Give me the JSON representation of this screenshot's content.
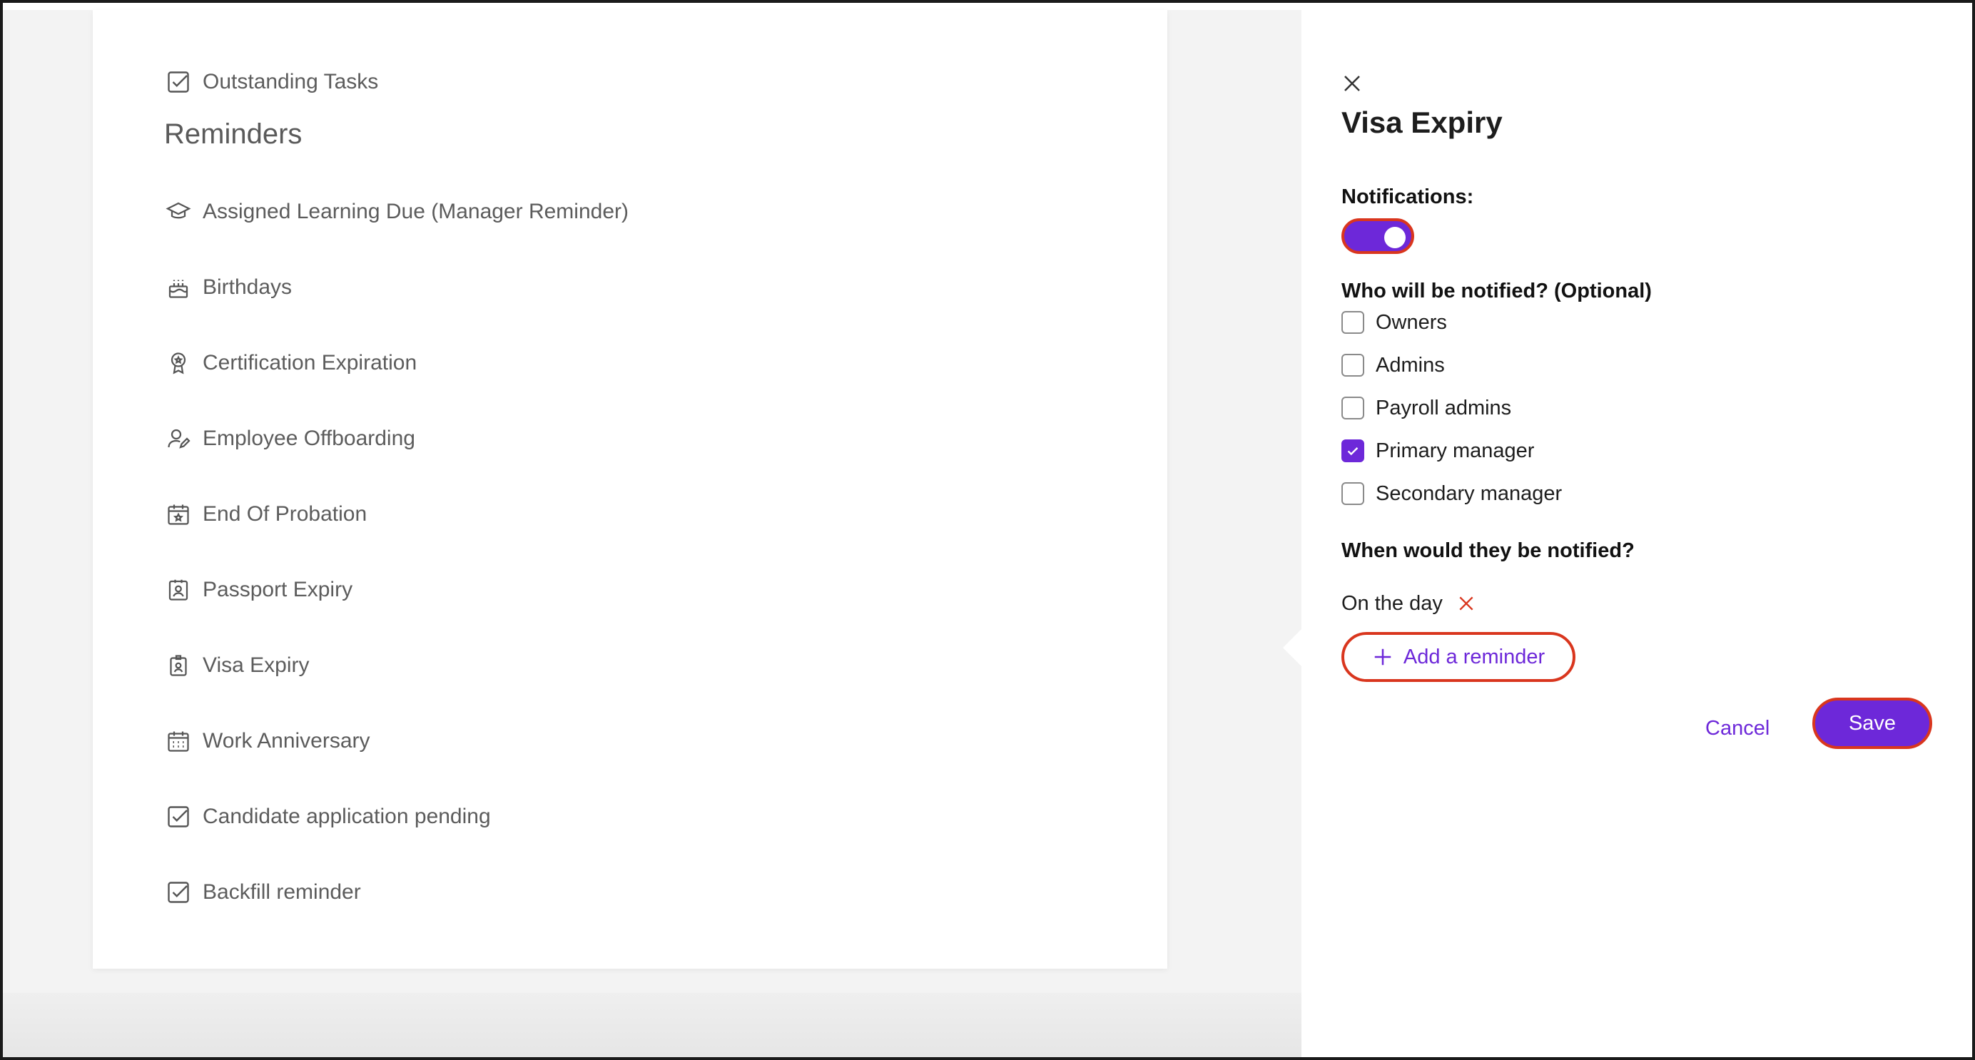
{
  "left_card": {
    "outstanding_tasks": {
      "label": "Outstanding Tasks",
      "icon": "checkbox-icon"
    },
    "reminders_title": "Reminders",
    "items": [
      {
        "label": "Assigned Learning Due (Manager Reminder)",
        "icon": "graduation-cap-icon"
      },
      {
        "label": "Birthdays",
        "icon": "cake-icon"
      },
      {
        "label": "Certification Expiration",
        "icon": "award-icon"
      },
      {
        "label": "Employee Offboarding",
        "icon": "user-edit-icon"
      },
      {
        "label": "End Of Probation",
        "icon": "calendar-star-icon"
      },
      {
        "label": "Passport Expiry",
        "icon": "id-card-icon"
      },
      {
        "label": "Visa Expiry",
        "icon": "badge-icon"
      },
      {
        "label": "Work Anniversary",
        "icon": "calendar-grid-icon"
      },
      {
        "label": "Candidate application pending",
        "icon": "checkbox-icon"
      },
      {
        "label": "Backfill reminder",
        "icon": "checkbox-icon"
      }
    ]
  },
  "panel": {
    "title": "Visa Expiry",
    "notifications_label": "Notifications:",
    "notifications_on": true,
    "who_label": "Who will be notified? (Optional)",
    "recipients": [
      {
        "label": "Owners",
        "checked": false
      },
      {
        "label": "Admins",
        "checked": false
      },
      {
        "label": "Payroll admins",
        "checked": false
      },
      {
        "label": "Primary manager",
        "checked": true
      },
      {
        "label": "Secondary manager",
        "checked": false
      }
    ],
    "when_label": "When would they be notified?",
    "reminder_entry": "On the day",
    "add_reminder_label": "Add a reminder",
    "cancel_label": "Cancel",
    "save_label": "Save"
  },
  "colors": {
    "accent": "#6d28d9",
    "highlight_outline": "#d9361e",
    "remove_x": "#d9361e"
  }
}
